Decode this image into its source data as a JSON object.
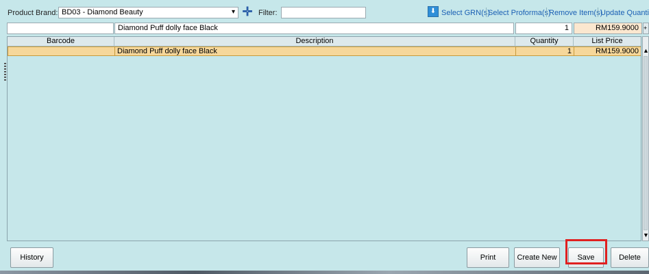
{
  "toolbar": {
    "brand_label": "Product Brand:",
    "brand_value": "BD03 - Diamond Beauty",
    "filter_label": "Filter:",
    "filter_value": "",
    "links": [
      "Select GRN(s)",
      "Select Proforma(s)",
      "Remove Item(s)",
      "Update Quantit"
    ]
  },
  "entry": {
    "barcode": "",
    "description": "Diamond Puff dolly face Black",
    "quantity": "1",
    "list_price": "RM159.9000"
  },
  "grid": {
    "columns": [
      "Barcode",
      "Description",
      "Quantity",
      "List Price"
    ],
    "rows": [
      {
        "barcode": "",
        "description": "Diamond Puff dolly face Black",
        "quantity": "1",
        "list_price": "RM159.9000"
      }
    ]
  },
  "buttons": {
    "history": "History",
    "print": "Print",
    "create_new": "Create New",
    "save": "Save",
    "delete": "Delete"
  },
  "colors": {
    "background": "#c6e7ea",
    "selected_row": "#f6d79a",
    "link": "#1a5fb4",
    "highlight": "#e02020"
  }
}
